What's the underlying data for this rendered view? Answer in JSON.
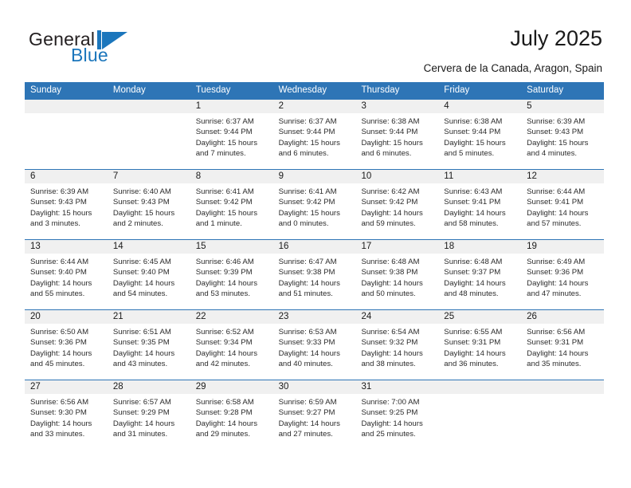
{
  "logo": {
    "word_one": "General",
    "word_two": "Blue",
    "mark": "flag-triangle-icon",
    "color_dark": "#231f20",
    "color_blue": "#1b76bc"
  },
  "header": {
    "title": "July 2025",
    "subtitle": "Cervera de la Canada, Aragon, Spain"
  },
  "theme": {
    "header_blue": "#2e75b6",
    "daynum_band": "#f0f0f0",
    "text": "#1a1a1a"
  },
  "weekdays": [
    "Sunday",
    "Monday",
    "Tuesday",
    "Wednesday",
    "Thursday",
    "Friday",
    "Saturday"
  ],
  "weeks": [
    [
      {
        "day": "",
        "sunrise": "",
        "sunset": "",
        "daylight_line1": "",
        "daylight_line2": ""
      },
      {
        "day": "",
        "sunrise": "",
        "sunset": "",
        "daylight_line1": "",
        "daylight_line2": ""
      },
      {
        "day": "1",
        "sunrise": "Sunrise: 6:37 AM",
        "sunset": "Sunset: 9:44 PM",
        "daylight_line1": "Daylight: 15 hours",
        "daylight_line2": "and 7 minutes."
      },
      {
        "day": "2",
        "sunrise": "Sunrise: 6:37 AM",
        "sunset": "Sunset: 9:44 PM",
        "daylight_line1": "Daylight: 15 hours",
        "daylight_line2": "and 6 minutes."
      },
      {
        "day": "3",
        "sunrise": "Sunrise: 6:38 AM",
        "sunset": "Sunset: 9:44 PM",
        "daylight_line1": "Daylight: 15 hours",
        "daylight_line2": "and 6 minutes."
      },
      {
        "day": "4",
        "sunrise": "Sunrise: 6:38 AM",
        "sunset": "Sunset: 9:44 PM",
        "daylight_line1": "Daylight: 15 hours",
        "daylight_line2": "and 5 minutes."
      },
      {
        "day": "5",
        "sunrise": "Sunrise: 6:39 AM",
        "sunset": "Sunset: 9:43 PM",
        "daylight_line1": "Daylight: 15 hours",
        "daylight_line2": "and 4 minutes."
      }
    ],
    [
      {
        "day": "6",
        "sunrise": "Sunrise: 6:39 AM",
        "sunset": "Sunset: 9:43 PM",
        "daylight_line1": "Daylight: 15 hours",
        "daylight_line2": "and 3 minutes."
      },
      {
        "day": "7",
        "sunrise": "Sunrise: 6:40 AM",
        "sunset": "Sunset: 9:43 PM",
        "daylight_line1": "Daylight: 15 hours",
        "daylight_line2": "and 2 minutes."
      },
      {
        "day": "8",
        "sunrise": "Sunrise: 6:41 AM",
        "sunset": "Sunset: 9:42 PM",
        "daylight_line1": "Daylight: 15 hours",
        "daylight_line2": "and 1 minute."
      },
      {
        "day": "9",
        "sunrise": "Sunrise: 6:41 AM",
        "sunset": "Sunset: 9:42 PM",
        "daylight_line1": "Daylight: 15 hours",
        "daylight_line2": "and 0 minutes."
      },
      {
        "day": "10",
        "sunrise": "Sunrise: 6:42 AM",
        "sunset": "Sunset: 9:42 PM",
        "daylight_line1": "Daylight: 14 hours",
        "daylight_line2": "and 59 minutes."
      },
      {
        "day": "11",
        "sunrise": "Sunrise: 6:43 AM",
        "sunset": "Sunset: 9:41 PM",
        "daylight_line1": "Daylight: 14 hours",
        "daylight_line2": "and 58 minutes."
      },
      {
        "day": "12",
        "sunrise": "Sunrise: 6:44 AM",
        "sunset": "Sunset: 9:41 PM",
        "daylight_line1": "Daylight: 14 hours",
        "daylight_line2": "and 57 minutes."
      }
    ],
    [
      {
        "day": "13",
        "sunrise": "Sunrise: 6:44 AM",
        "sunset": "Sunset: 9:40 PM",
        "daylight_line1": "Daylight: 14 hours",
        "daylight_line2": "and 55 minutes."
      },
      {
        "day": "14",
        "sunrise": "Sunrise: 6:45 AM",
        "sunset": "Sunset: 9:40 PM",
        "daylight_line1": "Daylight: 14 hours",
        "daylight_line2": "and 54 minutes."
      },
      {
        "day": "15",
        "sunrise": "Sunrise: 6:46 AM",
        "sunset": "Sunset: 9:39 PM",
        "daylight_line1": "Daylight: 14 hours",
        "daylight_line2": "and 53 minutes."
      },
      {
        "day": "16",
        "sunrise": "Sunrise: 6:47 AM",
        "sunset": "Sunset: 9:38 PM",
        "daylight_line1": "Daylight: 14 hours",
        "daylight_line2": "and 51 minutes."
      },
      {
        "day": "17",
        "sunrise": "Sunrise: 6:48 AM",
        "sunset": "Sunset: 9:38 PM",
        "daylight_line1": "Daylight: 14 hours",
        "daylight_line2": "and 50 minutes."
      },
      {
        "day": "18",
        "sunrise": "Sunrise: 6:48 AM",
        "sunset": "Sunset: 9:37 PM",
        "daylight_line1": "Daylight: 14 hours",
        "daylight_line2": "and 48 minutes."
      },
      {
        "day": "19",
        "sunrise": "Sunrise: 6:49 AM",
        "sunset": "Sunset: 9:36 PM",
        "daylight_line1": "Daylight: 14 hours",
        "daylight_line2": "and 47 minutes."
      }
    ],
    [
      {
        "day": "20",
        "sunrise": "Sunrise: 6:50 AM",
        "sunset": "Sunset: 9:36 PM",
        "daylight_line1": "Daylight: 14 hours",
        "daylight_line2": "and 45 minutes."
      },
      {
        "day": "21",
        "sunrise": "Sunrise: 6:51 AM",
        "sunset": "Sunset: 9:35 PM",
        "daylight_line1": "Daylight: 14 hours",
        "daylight_line2": "and 43 minutes."
      },
      {
        "day": "22",
        "sunrise": "Sunrise: 6:52 AM",
        "sunset": "Sunset: 9:34 PM",
        "daylight_line1": "Daylight: 14 hours",
        "daylight_line2": "and 42 minutes."
      },
      {
        "day": "23",
        "sunrise": "Sunrise: 6:53 AM",
        "sunset": "Sunset: 9:33 PM",
        "daylight_line1": "Daylight: 14 hours",
        "daylight_line2": "and 40 minutes."
      },
      {
        "day": "24",
        "sunrise": "Sunrise: 6:54 AM",
        "sunset": "Sunset: 9:32 PM",
        "daylight_line1": "Daylight: 14 hours",
        "daylight_line2": "and 38 minutes."
      },
      {
        "day": "25",
        "sunrise": "Sunrise: 6:55 AM",
        "sunset": "Sunset: 9:31 PM",
        "daylight_line1": "Daylight: 14 hours",
        "daylight_line2": "and 36 minutes."
      },
      {
        "day": "26",
        "sunrise": "Sunrise: 6:56 AM",
        "sunset": "Sunset: 9:31 PM",
        "daylight_line1": "Daylight: 14 hours",
        "daylight_line2": "and 35 minutes."
      }
    ],
    [
      {
        "day": "27",
        "sunrise": "Sunrise: 6:56 AM",
        "sunset": "Sunset: 9:30 PM",
        "daylight_line1": "Daylight: 14 hours",
        "daylight_line2": "and 33 minutes."
      },
      {
        "day": "28",
        "sunrise": "Sunrise: 6:57 AM",
        "sunset": "Sunset: 9:29 PM",
        "daylight_line1": "Daylight: 14 hours",
        "daylight_line2": "and 31 minutes."
      },
      {
        "day": "29",
        "sunrise": "Sunrise: 6:58 AM",
        "sunset": "Sunset: 9:28 PM",
        "daylight_line1": "Daylight: 14 hours",
        "daylight_line2": "and 29 minutes."
      },
      {
        "day": "30",
        "sunrise": "Sunrise: 6:59 AM",
        "sunset": "Sunset: 9:27 PM",
        "daylight_line1": "Daylight: 14 hours",
        "daylight_line2": "and 27 minutes."
      },
      {
        "day": "31",
        "sunrise": "Sunrise: 7:00 AM",
        "sunset": "Sunset: 9:25 PM",
        "daylight_line1": "Daylight: 14 hours",
        "daylight_line2": "and 25 minutes."
      },
      {
        "day": "",
        "sunrise": "",
        "sunset": "",
        "daylight_line1": "",
        "daylight_line2": ""
      },
      {
        "day": "",
        "sunrise": "",
        "sunset": "",
        "daylight_line1": "",
        "daylight_line2": ""
      }
    ]
  ]
}
